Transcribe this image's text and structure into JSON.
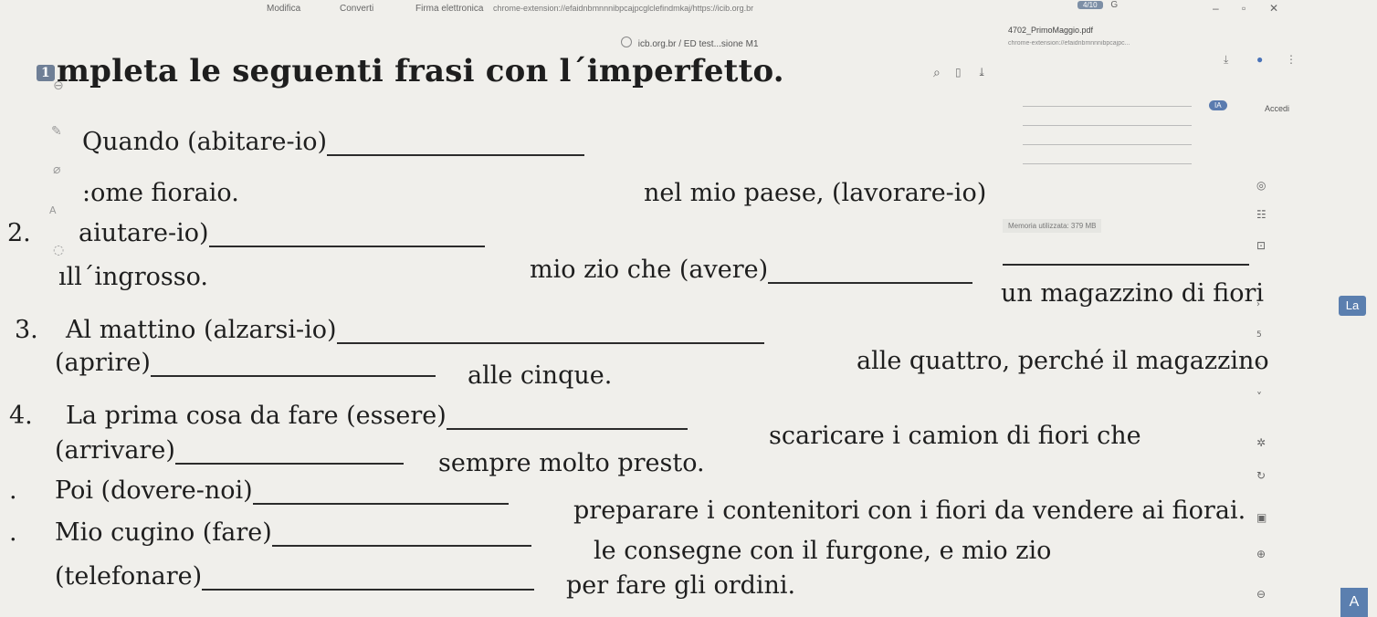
{
  "browser": {
    "menu": [
      "Modifica",
      "Converti",
      "Firma elettronica"
    ],
    "url": "chrome-extension://efaidnbmnnnibpcajpcglclefindmkaj/https://icib.org.br",
    "tab_count": "4/10",
    "bookmark": "icb.org.br / ED test...sione M1",
    "pdf_name": "4702_PrimoMaggio.pdf",
    "pdf_url": "chrome-extension://efaidnbmnnnibpcajpc...",
    "ia_label": "IA",
    "accedi_label": "Accedi",
    "memory_label": "Memoria utilizzata: 379 MB",
    "la_button": "La",
    "a_button": "A",
    "page_arrow": "›",
    "page_num": "5"
  },
  "exercise": {
    "title": "mpleta le seguenti frasi con l´imperfetto.",
    "title_num": "1",
    "lines": {
      "l1a": "Quando (abitare-io)",
      "l1b": ":ome fioraio.",
      "l1c": "nel mio paese, (lavorare-io)",
      "l2num": "2.",
      "l2a": "aiutare-io)",
      "l2b": "mio zio che (avere)",
      "l2c": "ıll´ingrosso.",
      "l2d": "un magazzino di fiori",
      "l3num": "3.",
      "l3a": "Al mattino (alzarsi-io)",
      "l3b": "(aprire)",
      "l3c": "alle cinque.",
      "l3d": "alle quattro, perché il magazzino",
      "l4num": "4.",
      "l4a": "La prima cosa da fare (essere)",
      "l4b": "scaricare i camion di fiori che",
      "l4c": "(arrivare)",
      "l4d": "sempre molto presto.",
      "l5num": ".",
      "l5a": "Poi (dovere-noi)",
      "l5b": "preparare i contenitori con i fiori da vendere ai fiorai.",
      "l6num": ".",
      "l6a": "Mio cugino (fare)",
      "l6b": "le consegne con il furgone, e mio zio",
      "l6c": "(telefonare)",
      "l6d": "per fare gli ordini."
    }
  }
}
